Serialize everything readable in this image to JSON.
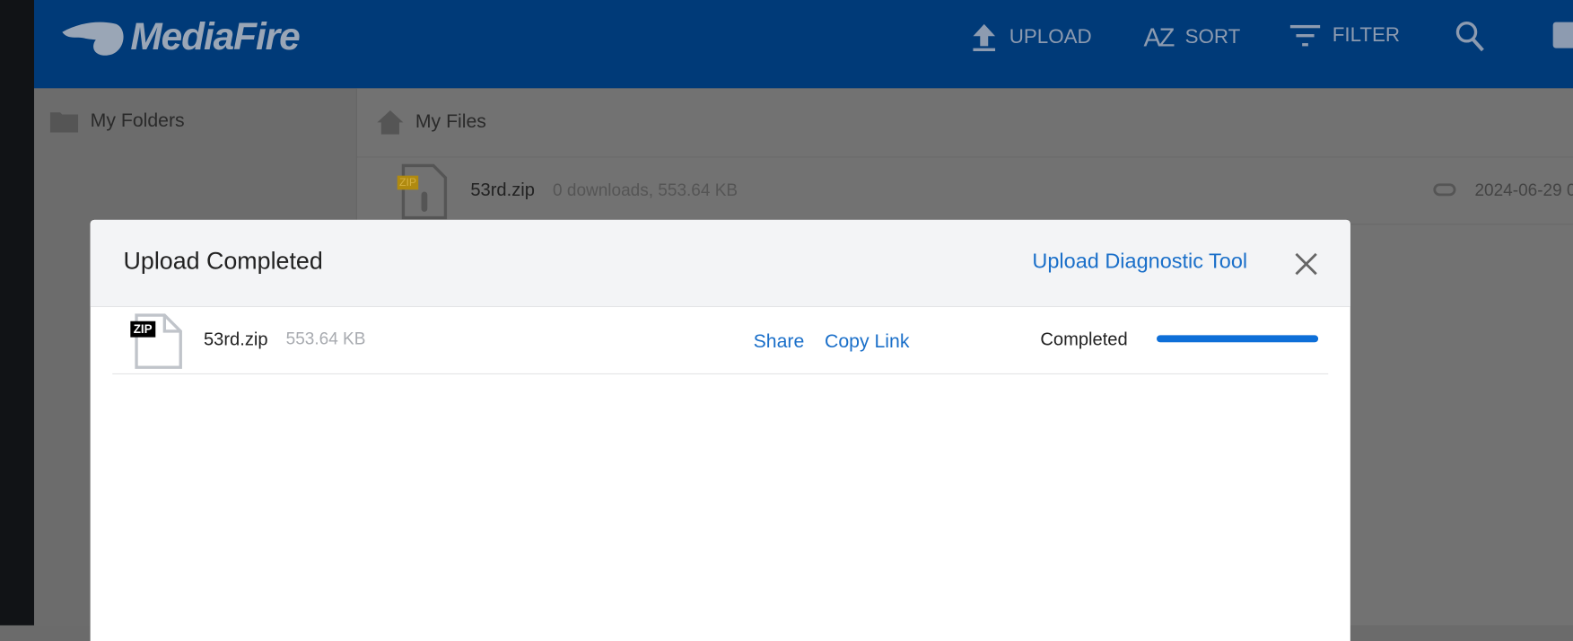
{
  "header": {
    "logo": "MediaFire",
    "upload": "UPLOAD",
    "sort": "SORT",
    "filter": "FILTER",
    "sort_icon_text": "AZ"
  },
  "sidebar": {
    "my_folders": "My Folders"
  },
  "main": {
    "breadcrumb": "My Files",
    "file": {
      "name": "53rd.zip",
      "meta": "0 downloads, 553.64 KB",
      "date": "2024-06-29 0",
      "badge": "ZIP"
    }
  },
  "modal": {
    "title": "Upload Completed",
    "diagnostic": "Upload Diagnostic Tool",
    "item": {
      "badge": "ZIP",
      "name": "53rd.zip",
      "size": "553.64 KB",
      "share": "Share",
      "copy_link": "Copy Link",
      "status": "Completed",
      "progress": 100
    },
    "colors": {
      "accent": "#1a6fc9",
      "progress": "#0e6fd8"
    }
  }
}
